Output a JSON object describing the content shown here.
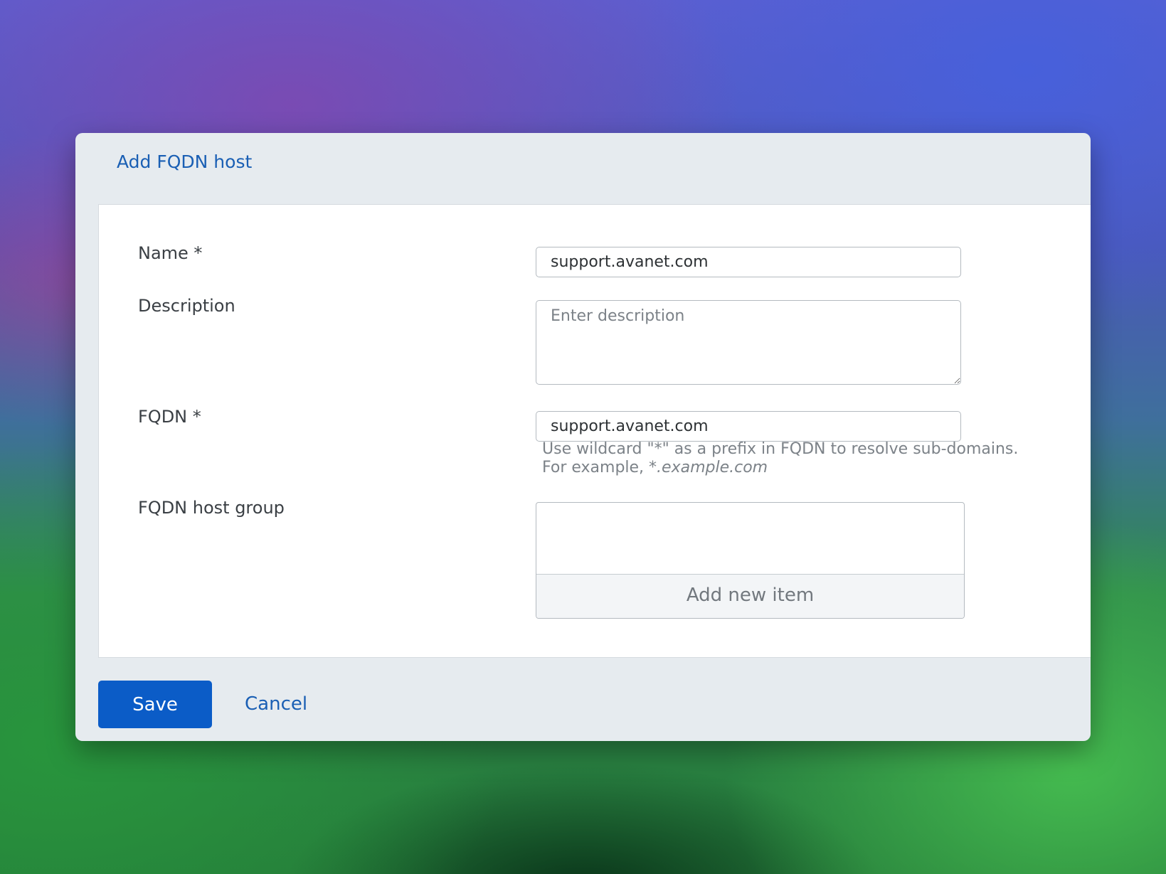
{
  "dialog": {
    "title": "Add FQDN host"
  },
  "form": {
    "name": {
      "label": "Name *",
      "value": "support.avanet.com"
    },
    "description": {
      "label": "Description",
      "placeholder": "Enter description",
      "value": ""
    },
    "fqdn": {
      "label": "FQDN *",
      "value": "support.avanet.com",
      "hint_line1": "Use wildcard \"*\" as a prefix in FQDN to resolve sub-domains.",
      "hint_line2_prefix": "For example, ",
      "hint_line2_example": "*.example.com"
    },
    "host_group": {
      "label": "FQDN host group",
      "add_item_label": "Add new item"
    }
  },
  "footer": {
    "save_label": "Save",
    "cancel_label": "Cancel"
  },
  "colors": {
    "accent": "#0b5cc7",
    "link": "#1a5fb4",
    "dialog_background": "#e6ebef"
  }
}
